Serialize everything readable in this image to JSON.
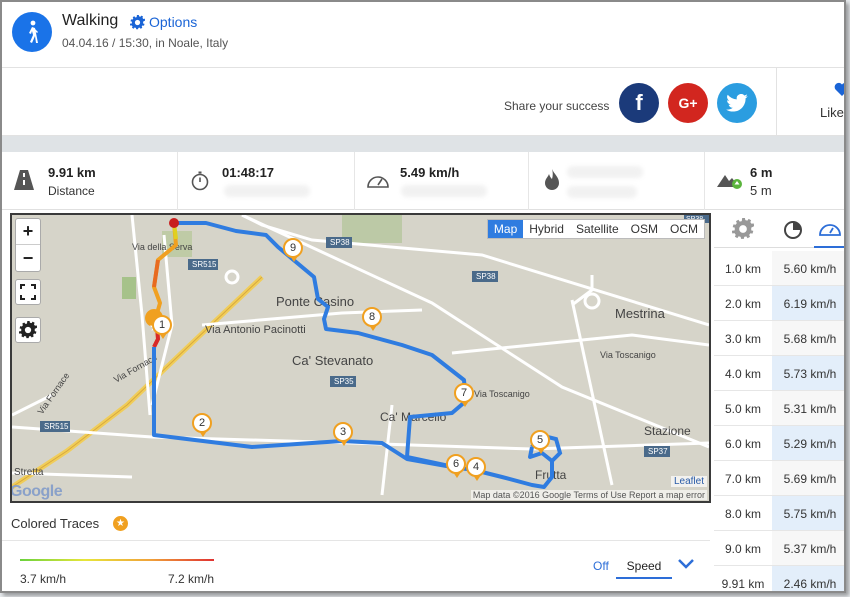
{
  "header": {
    "activity": "Walking",
    "options_label": "Options",
    "subtitle": "04.04.16 / 15:30, in Noale, Italy"
  },
  "share": {
    "label": "Share your success",
    "facebook": "f",
    "google_plus": "G+",
    "likes_label": "Likes"
  },
  "stats": {
    "distance_value": "9.91 km",
    "distance_label": "Distance",
    "duration_value": "01:48:17",
    "speed_value": "5.49 km/h",
    "elevation_value": "6 m",
    "elevation_sub": "5 m"
  },
  "map": {
    "tabs": [
      "Map",
      "Hybrid",
      "Satellite",
      "OSM",
      "OCM"
    ],
    "active_tab": "Map",
    "zoom_in": "+",
    "zoom_out": "−",
    "leaflet": "Leaflet",
    "attribution": "Map data ©2016 Google   Terms of Use   Report a map error",
    "google": "Google",
    "place_labels": [
      "Ponte Casino",
      "Ca' Stevanato",
      "Ca' Marcello",
      "Mestrina",
      "Stazione",
      "Frutta",
      "Via Antonio Pacinotti",
      "Via Toscanigo",
      "Via Toscanigo",
      "Via Fornace",
      "Via Fornace",
      "Stretta",
      "Via della Serva",
      "SR515",
      "SR515",
      "SP38",
      "SP38",
      "SP35",
      "SP37",
      "SP38"
    ],
    "markers": [
      "1",
      "2",
      "3",
      "4",
      "5",
      "6",
      "7",
      "8",
      "9"
    ]
  },
  "traces": {
    "label": "Colored Traces",
    "min_speed": "3.7 km/h",
    "max_speed": "7.2 km/h",
    "off_label": "Off",
    "selected": "Speed"
  },
  "splits": {
    "rows": [
      {
        "km": "1.0 km",
        "speed": "5.60 km/h"
      },
      {
        "km": "2.0 km",
        "speed": "6.19 km/h"
      },
      {
        "km": "3.0 km",
        "speed": "5.68 km/h"
      },
      {
        "km": "4.0 km",
        "speed": "5.73 km/h"
      },
      {
        "km": "5.0 km",
        "speed": "5.31 km/h"
      },
      {
        "km": "6.0 km",
        "speed": "5.29 km/h"
      },
      {
        "km": "7.0 km",
        "speed": "5.69 km/h"
      },
      {
        "km": "8.0 km",
        "speed": "5.75 km/h"
      },
      {
        "km": "9.0 km",
        "speed": "5.37 km/h"
      },
      {
        "km": "9.91 km",
        "speed": "2.46 km/h"
      }
    ]
  },
  "colors": {
    "accent": "#2d6ed8",
    "route": "#2f7ce0",
    "marker": "#f0a020"
  }
}
